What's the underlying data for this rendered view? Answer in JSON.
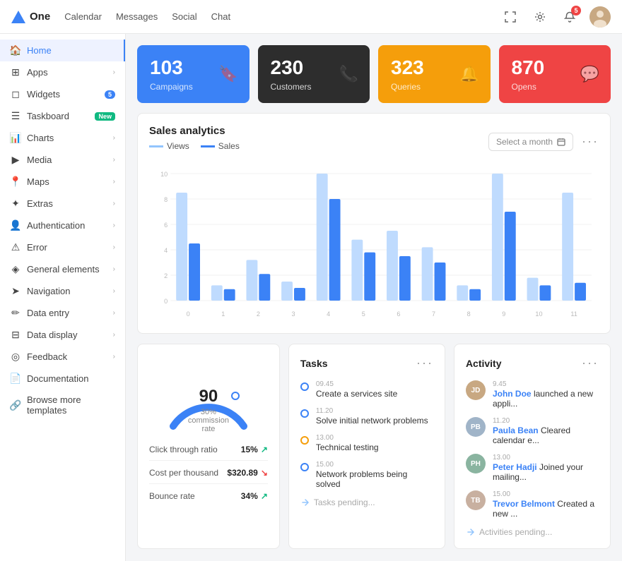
{
  "topnav": {
    "logo": "One",
    "links": [
      "Calendar",
      "Messages",
      "Social",
      "Chat"
    ],
    "notifications_count": "5"
  },
  "sidebar": {
    "items": [
      {
        "id": "home",
        "label": "Home",
        "icon": "🏠",
        "active": true,
        "badge": null,
        "chevron": false
      },
      {
        "id": "apps",
        "label": "Apps",
        "icon": "⊞",
        "active": false,
        "badge": null,
        "chevron": true
      },
      {
        "id": "widgets",
        "label": "Widgets",
        "icon": "◻",
        "active": false,
        "badge": "5",
        "badge_type": "number",
        "chevron": false
      },
      {
        "id": "taskboard",
        "label": "Taskboard",
        "icon": "☰",
        "active": false,
        "badge": "New",
        "badge_type": "new",
        "chevron": false
      },
      {
        "id": "charts",
        "label": "Charts",
        "icon": "📊",
        "active": false,
        "badge": null,
        "chevron": true
      },
      {
        "id": "media",
        "label": "Media",
        "icon": "▶",
        "active": false,
        "badge": null,
        "chevron": true
      },
      {
        "id": "maps",
        "label": "Maps",
        "icon": "📍",
        "active": false,
        "badge": null,
        "chevron": true
      },
      {
        "id": "extras",
        "label": "Extras",
        "icon": "✦",
        "active": false,
        "badge": null,
        "chevron": true
      },
      {
        "id": "authentication",
        "label": "Authentication",
        "icon": "👤",
        "active": false,
        "badge": null,
        "chevron": true
      },
      {
        "id": "error",
        "label": "Error",
        "icon": "⚠",
        "active": false,
        "badge": null,
        "chevron": true
      },
      {
        "id": "general",
        "label": "General elements",
        "icon": "◈",
        "active": false,
        "badge": null,
        "chevron": true
      },
      {
        "id": "navigation",
        "label": "Navigation",
        "icon": "➤",
        "active": false,
        "badge": null,
        "chevron": true
      },
      {
        "id": "dataentry",
        "label": "Data entry",
        "icon": "✏",
        "active": false,
        "badge": null,
        "chevron": true
      },
      {
        "id": "datadisplay",
        "label": "Data display",
        "icon": "⊟",
        "active": false,
        "badge": null,
        "chevron": true
      },
      {
        "id": "feedback",
        "label": "Feedback",
        "icon": "◎",
        "active": false,
        "badge": null,
        "chevron": true
      },
      {
        "id": "documentation",
        "label": "Documentation",
        "icon": "📄",
        "active": false,
        "badge": null,
        "chevron": false
      },
      {
        "id": "browse",
        "label": "Browse more templates",
        "icon": "🔗",
        "active": false,
        "badge": null,
        "chevron": false
      }
    ]
  },
  "stats": [
    {
      "number": "103",
      "label": "Campaigns",
      "icon": "🔖",
      "color": "blue"
    },
    {
      "number": "230",
      "label": "Customers",
      "icon": "📞",
      "color": "dark"
    },
    {
      "number": "323",
      "label": "Queries",
      "icon": "🔔",
      "color": "orange"
    },
    {
      "number": "870",
      "label": "Opens",
      "icon": "💬",
      "color": "red"
    }
  ],
  "analytics": {
    "title": "Sales analytics",
    "legend_views": "Views",
    "legend_sales": "Sales",
    "select_month_placeholder": "Select a month",
    "chart": {
      "x_labels": [
        "0",
        "1",
        "2",
        "3",
        "4",
        "5",
        "6",
        "7",
        "8",
        "9",
        "10",
        "11"
      ],
      "views": [
        8.5,
        1.2,
        3.2,
        1.5,
        10,
        4.8,
        5.5,
        4.2,
        1.2,
        10,
        1.8,
        8.5
      ],
      "sales": [
        4.5,
        0.9,
        2.1,
        1.0,
        8,
        3.8,
        3.5,
        3.0,
        0.9,
        7,
        1.2,
        1.4
      ],
      "y_max": 10
    }
  },
  "gauge": {
    "value": "90",
    "label": "30% commission rate",
    "percentage": 75
  },
  "metrics": [
    {
      "name": "Click through ratio",
      "value": "15%",
      "trend": "up"
    },
    {
      "name": "Cost per thousand",
      "value": "$320.89",
      "trend": "down"
    },
    {
      "name": "Bounce rate",
      "value": "34%",
      "trend": "up"
    }
  ],
  "tasks": {
    "title": "Tasks",
    "items": [
      {
        "time": "09.45",
        "name": "Create a services site",
        "type": "normal"
      },
      {
        "time": "11.20",
        "name": "Solve initial network problems",
        "type": "normal"
      },
      {
        "time": "13.00",
        "name": "Technical testing",
        "type": "orange"
      },
      {
        "time": "15.00",
        "name": "Network problems being solved",
        "type": "normal"
      }
    ],
    "pending": "Tasks pending..."
  },
  "activity": {
    "title": "Activity",
    "items": [
      {
        "time": "9.45",
        "name": "John Doe",
        "text": "launched a new appli...",
        "color": "#c8a882"
      },
      {
        "time": "11.20",
        "name": "Paula Bean",
        "text": "Cleared calendar e...",
        "color": "#a0b4c8"
      },
      {
        "time": "13.00",
        "name": "Peter Hadji",
        "text": "Joined your mailing...",
        "color": "#8ab4a0"
      },
      {
        "time": "15.00",
        "name": "Trevor Belmont",
        "text": "Created a new ...",
        "color": "#c8b0a0"
      }
    ],
    "pending": "Activities pending..."
  }
}
